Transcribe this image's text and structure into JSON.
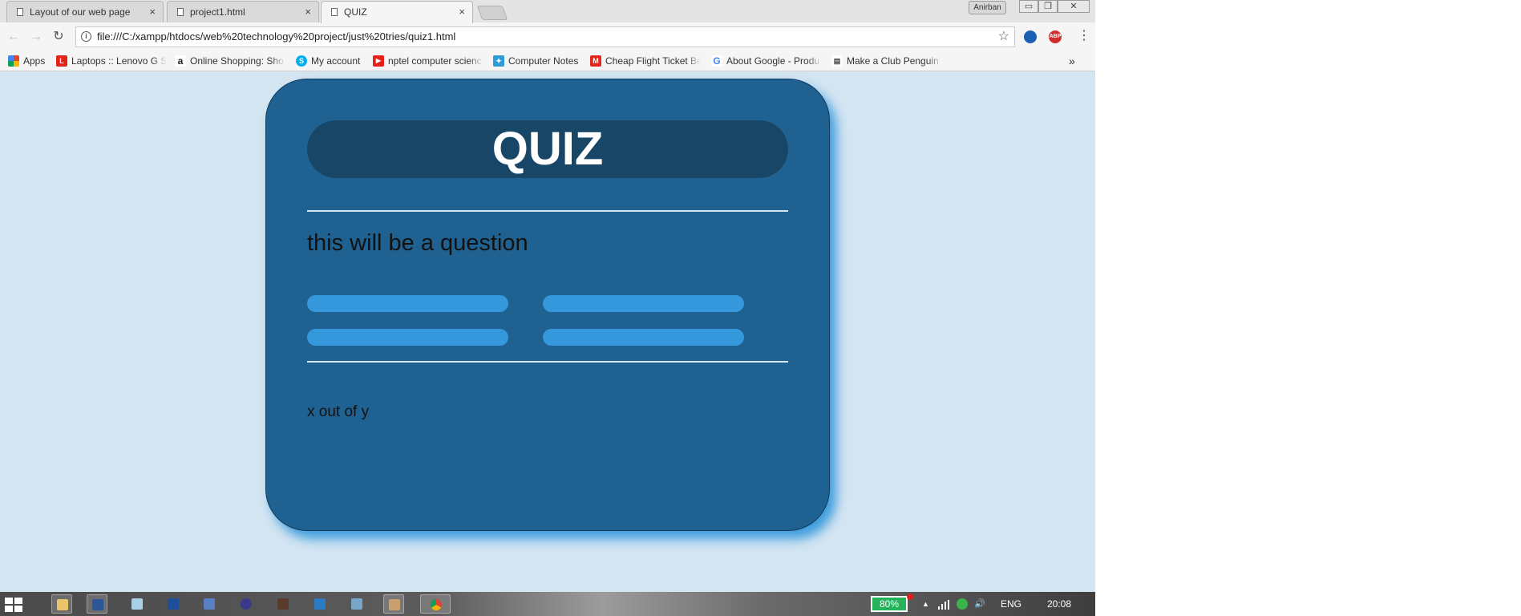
{
  "browser": {
    "tabs": [
      {
        "label": "Layout of our web page",
        "close": "×"
      },
      {
        "label": "project1.html",
        "close": "×"
      },
      {
        "label": "QUIZ",
        "close": "×"
      }
    ],
    "profile_name": "Anirban",
    "window_controls": {
      "minimize": "▭",
      "restore": "❐",
      "close": "✕"
    },
    "nav": {
      "back": "←",
      "forward": "→",
      "reload": "↻"
    },
    "url": "file:///C:/xampp/htdocs/web%20technology%20project/just%20tries/quiz1.html",
    "star_icon": "☆",
    "menu_icon": "⋮",
    "extensions": [
      {
        "name": "browser-extension-icon",
        "color": "#1a5fb4"
      },
      {
        "name": "adblock-plus-icon",
        "label": "ABP",
        "color": "#d22b2b"
      }
    ]
  },
  "bookmarks": {
    "items": [
      {
        "label": "Apps",
        "icon": "apps-grid-icon",
        "color": "#e04a2a"
      },
      {
        "label": "Laptops :: Lenovo G S",
        "icon": "lenovo-icon",
        "letter": "L",
        "color": "#e2231a"
      },
      {
        "label": "Online Shopping: Sho",
        "icon": "amazon-icon",
        "letter": "a",
        "color": "#222222"
      },
      {
        "label": "My account",
        "icon": "skype-icon",
        "letter": "S",
        "color": "#00aff0"
      },
      {
        "label": "nptel computer scienc",
        "icon": "youtube-icon",
        "letter": "▶",
        "color": "#e62117"
      },
      {
        "label": "Computer Notes",
        "icon": "computer-notes-icon",
        "letter": "✦",
        "color": "#2e9ad6"
      },
      {
        "label": "Cheap Flight Ticket Bo",
        "icon": "flight-site-icon",
        "letter": "M",
        "color": "#e2261c"
      },
      {
        "label": "About Google - Produ",
        "icon": "google-icon",
        "letter": "G",
        "color": "#4285f4"
      },
      {
        "label": "Make a Club Penguin",
        "icon": "club-penguin-icon",
        "letter": "▤",
        "color": "#444444"
      }
    ],
    "overflow": "»"
  },
  "quiz": {
    "title": "QUIZ",
    "question": "this will be a question",
    "score": "x out of y",
    "answer_count": 4,
    "colors": {
      "page_bg": "#d4e5f2",
      "card": "#1f6292",
      "banner": "#174666",
      "answer": "#3598dc",
      "shadow": "#3498db"
    }
  },
  "taskbar": {
    "battery": "80%",
    "language": "ENG",
    "time": "20:08",
    "tray_arrow": "▲",
    "volume_icon": "🔊"
  }
}
